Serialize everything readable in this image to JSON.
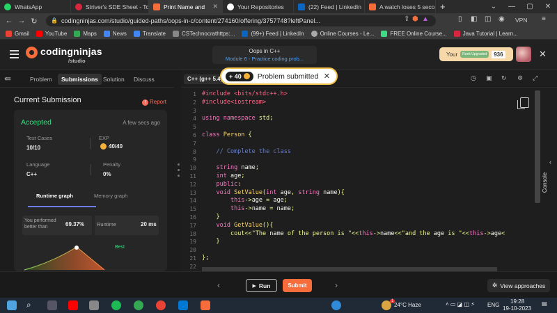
{
  "browser": {
    "tabs": [
      {
        "label": "WhatsApp",
        "color": "#25d366",
        "active": false
      },
      {
        "label": "Striver's SDE Sheet - Top",
        "color": "#d7263d",
        "active": false
      },
      {
        "label": "Print Name and",
        "color": "#f66c3b",
        "active": true
      },
      {
        "label": "Your Repositories",
        "color": "#ffffff",
        "active": false
      },
      {
        "label": "(22) Feed | LinkedIn",
        "color": "#0a66c2",
        "active": false
      },
      {
        "label": "A watch loses 5 seco",
        "color": "#f66c3b",
        "active": false
      }
    ],
    "new_tab": "+",
    "url": "codingninjas.com/studio/guided-paths/oops-in-c/content/274160/offering/3757748?leftPanel...",
    "vpn": "VPN",
    "bookmarks": [
      {
        "label": "Gmail",
        "color": "#ea4335"
      },
      {
        "label": "YouTube",
        "color": "#ff0000"
      },
      {
        "label": "Maps",
        "color": "#34a853"
      },
      {
        "label": "News",
        "color": "#4285f4"
      },
      {
        "label": "Translate",
        "color": "#4285f4"
      },
      {
        "label": "CSTechnocrathttps:...",
        "color": "#888888"
      },
      {
        "label": "(99+) Feed | LinkedIn",
        "color": "#0a66c2"
      },
      {
        "label": "Online Courses - Le...",
        "color": "#aaaaaa"
      },
      {
        "label": "FREE Online Course...",
        "color": "#3ddc84"
      },
      {
        "label": "Java Tutorial | Learn...",
        "color": "#d7263d"
      }
    ]
  },
  "header": {
    "logo": "codingninjas",
    "logo_sub": "/studio",
    "course_title": "Oops in C++",
    "course_module": "Module 6 - Practice coding prob...",
    "streak_label": "Your",
    "streak_badge": "Rank Upgraded",
    "streak_value": "936"
  },
  "left": {
    "tabs": [
      "Problem",
      "Submissions",
      "Solution",
      "Discuss"
    ],
    "active_tab": "Submissions",
    "section_title": "Current Submission",
    "report": "Report",
    "status": "Accepted",
    "time_ago": "A few secs ago",
    "test_cases_label": "Test Cases",
    "test_cases_value": "10/10",
    "exp_label": "EXP",
    "exp_value": "40/40",
    "language_label": "Language",
    "language_value": "C++",
    "penalty_label": "Penalty",
    "penalty_value": "0%",
    "graph_tabs": [
      "Runtime graph",
      "Memory graph"
    ],
    "performed_label": "You performed better than",
    "performed_value": "69.37%",
    "runtime_label": "Runtime",
    "runtime_value": "20 ms",
    "best_label": "Best"
  },
  "editor": {
    "language": "C++ (g++ 5.4)",
    "toast_exp": "+ 40",
    "toast_text": "Problem submitted",
    "console": "Console",
    "line_numbers": [
      "1",
      "2",
      "3",
      "4",
      "5",
      "6",
      "7",
      "8",
      "9",
      "10",
      "11",
      "12",
      "13",
      "14",
      "15",
      "16",
      "17",
      "18",
      "19",
      "20",
      "21",
      "22"
    ],
    "code": [
      "#include <bits/stdc++.h>",
      "#include<iostream>",
      "",
      "using namespace std;",
      "",
      "class Person {",
      "",
      "    // Complete the class",
      "",
      "    string name;",
      "    int age;",
      "    public:",
      "    void SetValue(int age, string name){",
      "        this->age = age;",
      "        this->name = name;",
      "    }",
      "    void GetValue(){",
      "        cout<<\"The name of the person is \"<<this->name<<\"and the age is \"<<this->age<",
      "    }",
      "",
      "};",
      ""
    ]
  },
  "actions": {
    "run": "Run",
    "submit": "Submit",
    "view_approaches": "View approaches"
  },
  "taskbar": {
    "weather": "24°C  Haze",
    "lang": "ENG",
    "time": "19:28",
    "date": "19-10-2023",
    "notif_count": "1"
  },
  "colors": {
    "accent": "#f66c3b",
    "accepted": "#3ddc84",
    "link": "#4aa3ff"
  }
}
